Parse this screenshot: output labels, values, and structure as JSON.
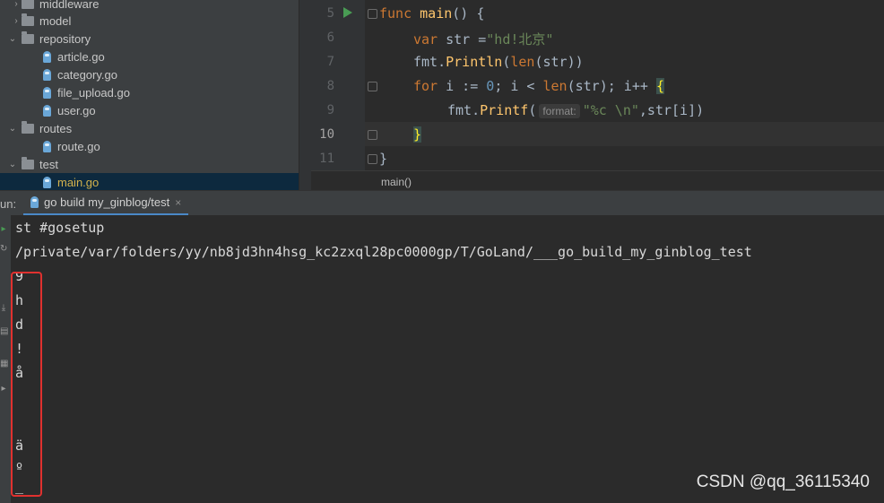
{
  "project_tree": [
    {
      "name": "middleware",
      "type": "folder",
      "expanded": false
    },
    {
      "name": "model",
      "type": "folder",
      "expanded": false
    },
    {
      "name": "repository",
      "type": "folder",
      "expanded": true
    },
    {
      "name": "article.go",
      "type": "file"
    },
    {
      "name": "category.go",
      "type": "file"
    },
    {
      "name": "file_upload.go",
      "type": "file"
    },
    {
      "name": "user.go",
      "type": "file"
    },
    {
      "name": "routes",
      "type": "folder",
      "expanded": true
    },
    {
      "name": "route.go",
      "type": "file"
    },
    {
      "name": "test",
      "type": "folder",
      "expanded": true
    },
    {
      "name": "main.go",
      "type": "file",
      "selected": true
    }
  ],
  "editor": {
    "line_numbers": [
      "5",
      "6",
      "7",
      "8",
      "9",
      "10",
      "11"
    ],
    "current_line": "10",
    "code": {
      "l5_kw": "func",
      "l5_fn": "main",
      "l5_rest": "() {",
      "l6_kw": "var",
      "l6_mid": " str =",
      "l6_str": "\"hd!北京\"",
      "l7_pkg": "fmt.",
      "l7_call": "Println",
      "l7_a": "(",
      "l7_bi": "len",
      "l7_b": "(str))",
      "l8_kw": "for",
      "l8_a": " i := ",
      "l8_num": "0",
      "l8_b": "; i < ",
      "l8_bi": "len",
      "l8_c": "(str); i++ ",
      "l8_brace": "{",
      "l9_pkg": "fmt.",
      "l9_call": "Printf",
      "l9_a": "(",
      "l9_hint": "format:",
      "l9_str": "\"%c \\n\"",
      "l9_b": ",str[i])",
      "l10": "}",
      "l11": "}"
    },
    "breadcrumb": "main()"
  },
  "run": {
    "label": "un:",
    "tab_label": "go build my_ginblog/test",
    "close": "×",
    "console_lines": [
      "st #gosetup",
      "/private/var/folders/yy/nb8jd3hn4hsg_kc2zxql28pc0000gp/T/GoLand/___go_build_my_ginblog_test",
      "9",
      "h",
      "d",
      "!",
      "å",
      "",
      "",
      "ä",
      "º",
      "_"
    ]
  },
  "watermark": "CSDN @qq_36115340",
  "colors": {
    "keyword": "#cc7832",
    "function": "#ffc66d",
    "string": "#6a8759",
    "number": "#6897bb",
    "highlight_box": "#e0312f"
  }
}
